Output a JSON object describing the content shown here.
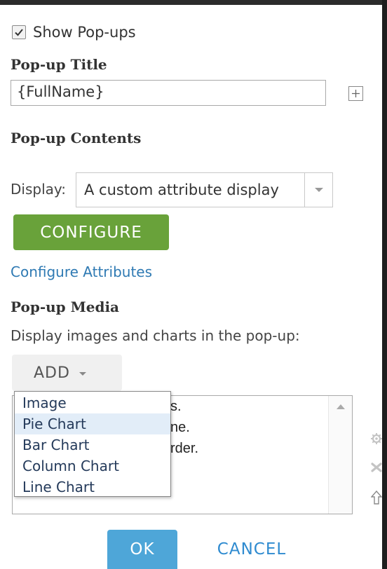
{
  "show_popups": {
    "label": "Show Pop-ups",
    "checked": true
  },
  "popup_title": {
    "heading": "Pop-up Title",
    "value": "{FullName}"
  },
  "popup_contents": {
    "heading": "Pop-up Contents",
    "display_label": "Display:",
    "display_value": "A custom attribute display",
    "configure_label": "CONFIGURE",
    "configure_attributes_link": "Configure Attributes"
  },
  "popup_media": {
    "heading": "Pop-up Media",
    "description": "Display images and charts in the pop-up:",
    "add_label": "ADD",
    "list_partial_lines": [
      "s.",
      "ne.",
      "rder."
    ]
  },
  "add_menu": {
    "items": [
      "Image",
      "Pie Chart",
      "Bar Chart",
      "Column Chart",
      "Line Chart"
    ],
    "highlighted": "Pie Chart"
  },
  "footer": {
    "ok_label": "OK",
    "cancel_label": "CANCEL"
  },
  "icons": [
    "checkmark-icon",
    "plus-icon",
    "caret-down-icon",
    "scroll-up-icon",
    "gear-icon",
    "delete-icon",
    "move-up-icon"
  ],
  "colors": {
    "configure_green": "#69a23a",
    "ok_blue": "#4ea6d8",
    "link_blue": "#2f7ab3",
    "menu_hover": "#e2edf8"
  }
}
